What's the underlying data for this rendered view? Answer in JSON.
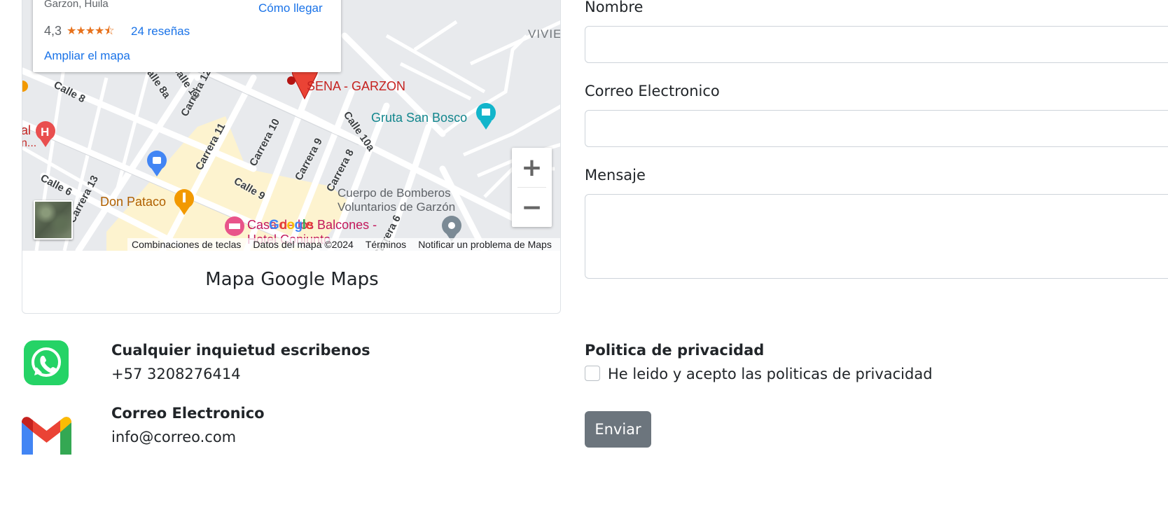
{
  "map": {
    "info": {
      "location": "Garzon, Huila",
      "directions": "Cómo llegar",
      "rating": "4,3",
      "stars": "★★★★⯪",
      "reviews": "24 reseñas",
      "enlarge": "Ampliar el mapa"
    },
    "labels": {
      "district": "VIVIE",
      "sena": "SENA - GARZON",
      "gruta": "Gruta San Bosco",
      "bomberos_1": "Cuerpo de Bomberos",
      "bomberos_2": "Voluntarios de Garzón",
      "don_pataco": "Don Pataco",
      "hotel_1": "Casa de los Balcones -",
      "hotel_2": "Hotel Conjunto",
      "hospital_1": "al",
      "hospital_2": "n...",
      "streets": {
        "calle_8": "Calle 8",
        "calle_8a": "Calle 8a",
        "calle_10_top": "Calle 10",
        "carrera_12": "Carrera 12",
        "carrera_11": "Carrera 11",
        "carrera_10": "Carrera 10",
        "carrera_9": "Carrera 9",
        "carrera_8": "Carrera 8",
        "calle_10a": "Calle 10a",
        "calle_9": "Calle 9",
        "calle_6": "Calle 6",
        "carrera_13": "Carrera 13",
        "carrera_6": "Carrera 6"
      }
    },
    "zoom_in": "+",
    "zoom_out": "−",
    "google_logo": [
      "G",
      "o",
      "o",
      "g",
      "l",
      "e"
    ],
    "attribution": {
      "shortcuts": "Combinaciones de teclas",
      "data": "Datos del mapa ©2024",
      "terms": "Términos",
      "report": "Notificar un problema de Maps"
    },
    "caption": "Mapa Google Maps"
  },
  "form": {
    "name_label": "Nombre",
    "email_label": "Correo Electronico",
    "message_label": "Mensaje",
    "name_value": "",
    "email_value": "",
    "message_value": ""
  },
  "contact": {
    "whatsapp_title": "Cualquier inquietud escribenos",
    "whatsapp_value": "+57 3208276414",
    "email_title": "Correo Electronico",
    "email_value": "info@correo.com"
  },
  "privacy": {
    "title": "Politica de privacidad",
    "checkbox_label": "He leido y acepto las politicas de privacidad",
    "checked": false
  },
  "submit_label": "Enviar",
  "colors": {
    "button_bg": "#6c757d",
    "map_link": "#1a73e8",
    "whatsapp_green": "#25d366",
    "marker_red": "#ea4335"
  }
}
